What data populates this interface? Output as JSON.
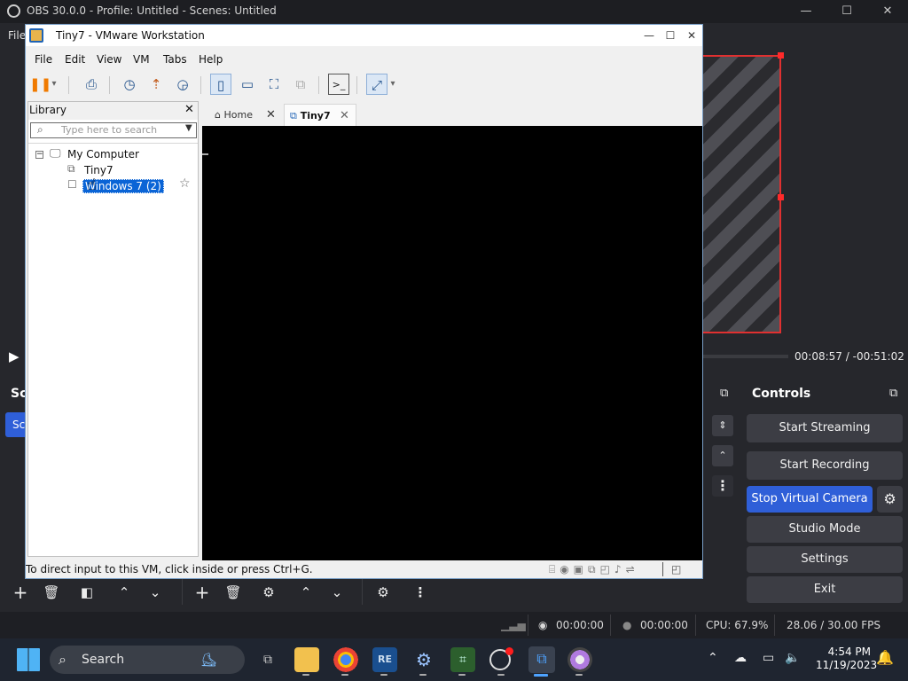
{
  "obs": {
    "title": "OBS 30.0.0 - Profile: Untitled - Scenes: Untitled",
    "menu_file": "File",
    "time_current": "00:08:57",
    "time_separator": "/",
    "time_remaining": "-00:51:02",
    "scenes_dock_title": "Sc",
    "scene_item": "Sc",
    "controls_title": "Controls",
    "controls": {
      "start_streaming": "Start Streaming",
      "start_recording": "Start Recording",
      "stop_virtual_camera": "Stop Virtual Camera",
      "studio_mode": "Studio Mode",
      "settings": "Settings",
      "exit": "Exit"
    },
    "status": {
      "stream_time": "00:00:00",
      "record_time": "00:00:00",
      "cpu": "CPU: 67.9%",
      "fps": "28.06 / 30.00 FPS"
    },
    "accent_color": "#2f5fd8",
    "canvas_border_color": "#e03030"
  },
  "vmware": {
    "title": "Tiny7 - VMware Workstation",
    "menu": [
      "File",
      "Edit",
      "View",
      "VM",
      "Tabs",
      "Help"
    ],
    "library_title": "Library",
    "search_placeholder": "Type here to search",
    "tree": {
      "root": "My Computer",
      "items": [
        "Tiny7",
        "Windows 7 (2)"
      ]
    },
    "tabs": {
      "home": "Home",
      "vm": "Tiny7"
    },
    "status_text": "To direct input to this VM, click inside or press Ctrl+G.",
    "accent_color": "#0a64d6"
  },
  "taskbar": {
    "search_label": "Search",
    "clock_time": "4:54 PM",
    "clock_date": "11/19/2023"
  }
}
